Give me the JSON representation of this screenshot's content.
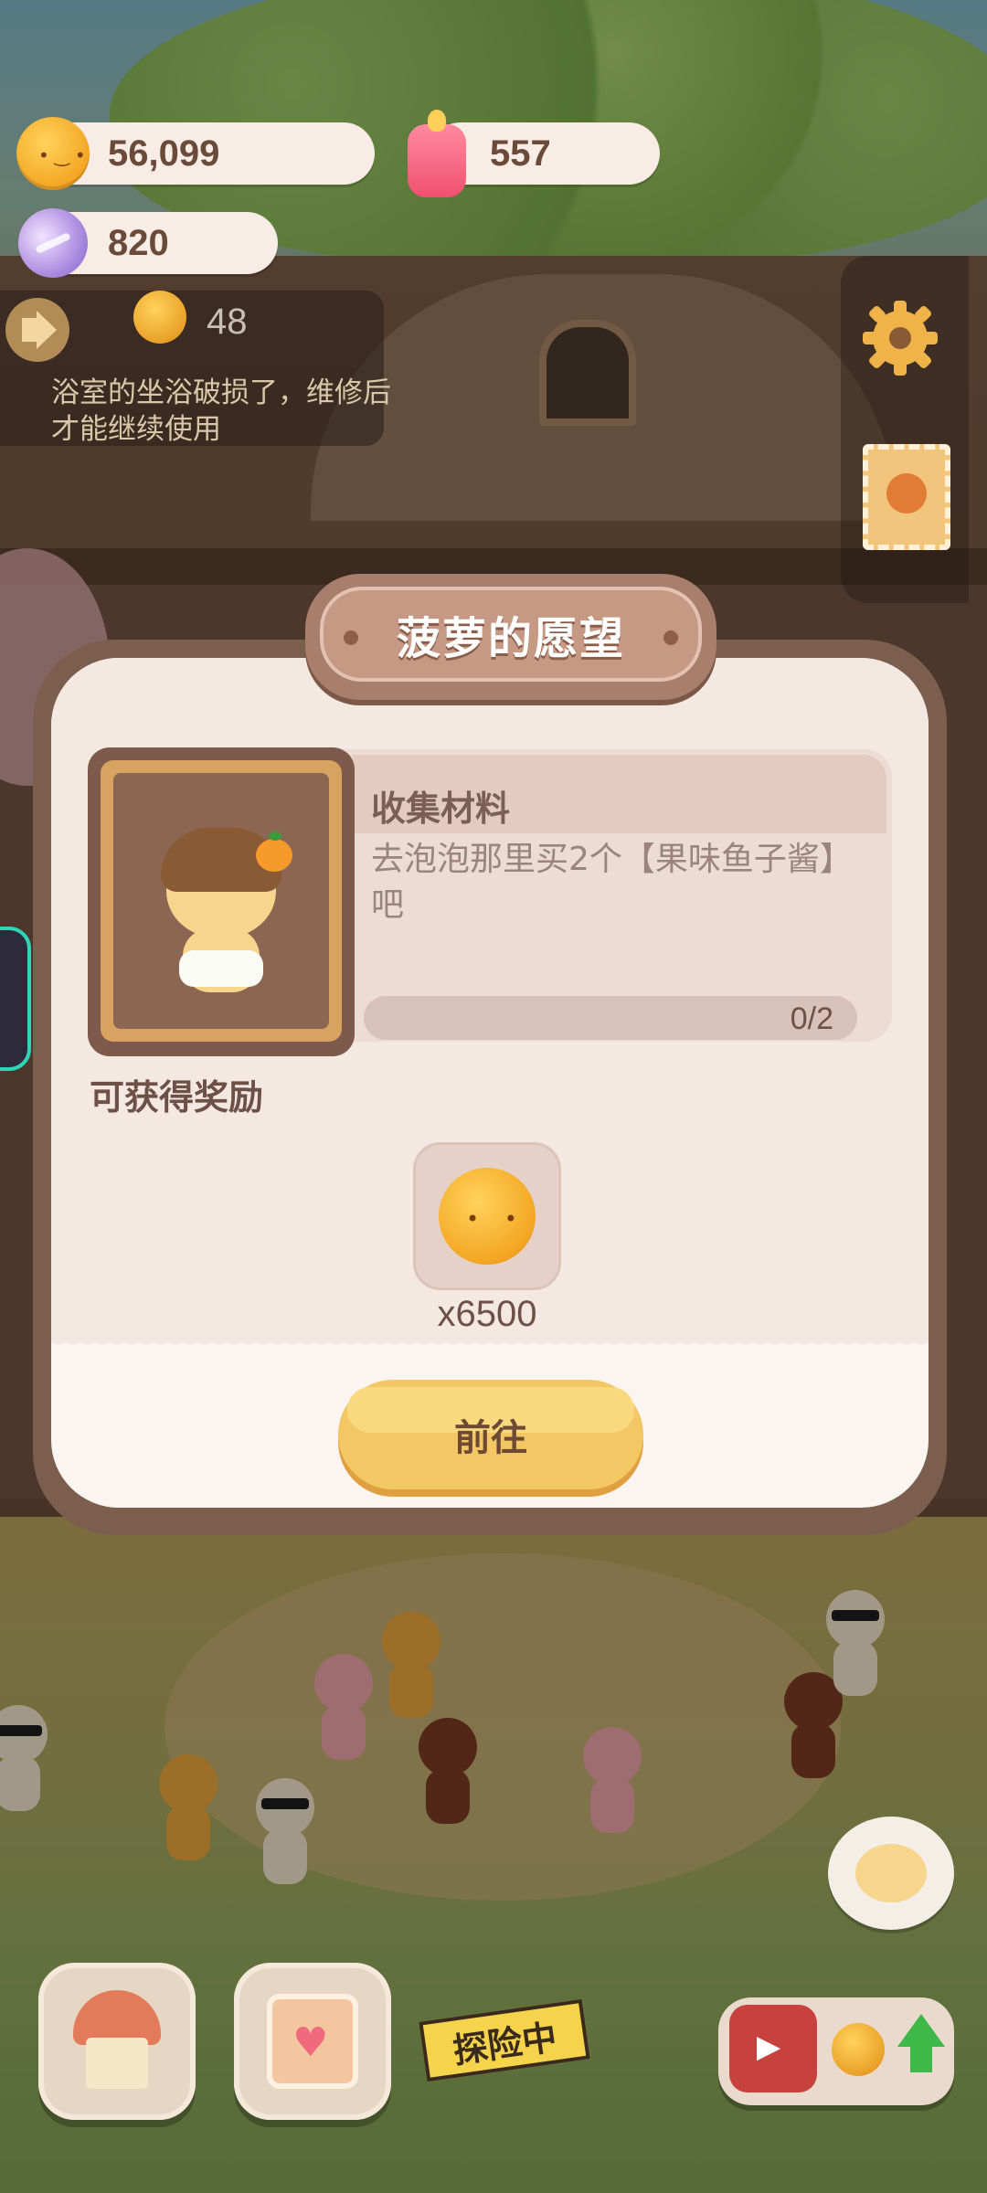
{
  "hud": {
    "cookies": "56,099",
    "candles": "557",
    "candies": "820",
    "timer_count": "48",
    "notice": "浴室的坐浴破损了，维修后才能继续使用"
  },
  "dialog": {
    "title": "菠萝的愿望",
    "task_title": "收集材料",
    "task_desc": "去泡泡那里买2个【果味鱼子酱】吧",
    "progress_text": "0/2",
    "progress_value": 0,
    "progress_max": 2,
    "reward_label": "可获得奖励",
    "reward_count": "x6500",
    "go_button": "前往"
  },
  "bottom_nav": {
    "explore_label": "探险中"
  },
  "colors": {
    "accent_button": "#f4c765",
    "title_plate": "#c69985",
    "dialog_bg": "#fbf5f1"
  }
}
